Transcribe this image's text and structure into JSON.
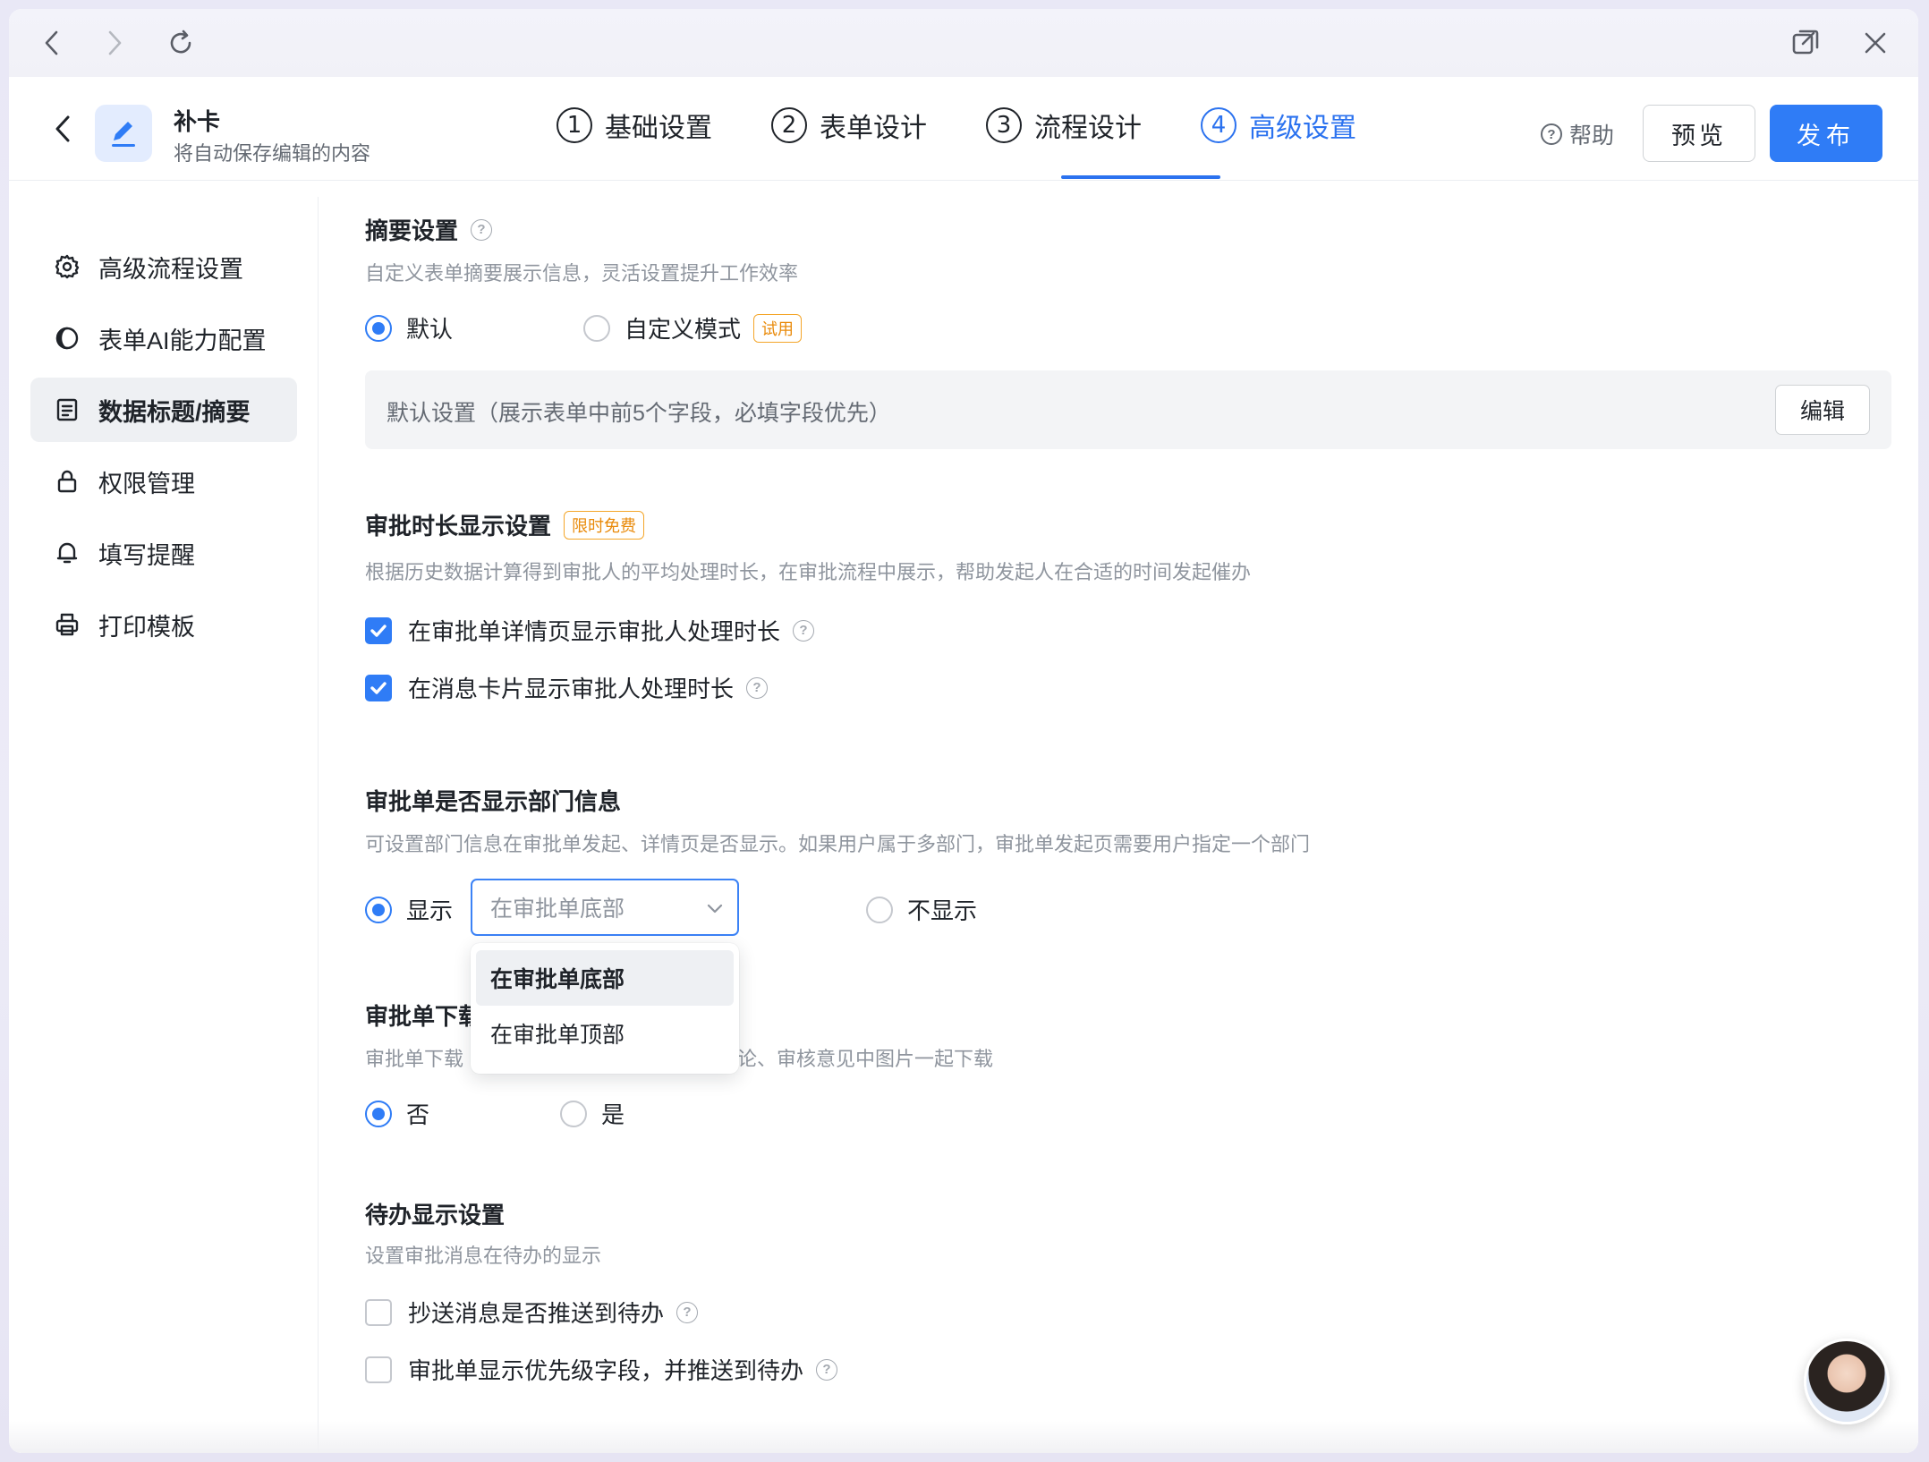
{
  "app": {
    "title": "补卡",
    "subtitle": "将自动保存编辑的内容"
  },
  "steps": [
    {
      "num": "1",
      "label": "基础设置",
      "active": false
    },
    {
      "num": "2",
      "label": "表单设计",
      "active": false
    },
    {
      "num": "3",
      "label": "流程设计",
      "active": false
    },
    {
      "num": "4",
      "label": "高级设置",
      "active": true
    }
  ],
  "header": {
    "help_label": "帮助",
    "preview_label": "预览",
    "publish_label": "发布"
  },
  "sidebar": {
    "items": [
      {
        "label": "高级流程设置",
        "icon": "gear-icon"
      },
      {
        "label": "表单AI能力配置",
        "icon": "ai-icon"
      },
      {
        "label": "数据标题/摘要",
        "icon": "document-icon",
        "active": true
      },
      {
        "label": "权限管理",
        "icon": "lock-icon"
      },
      {
        "label": "填写提醒",
        "icon": "bell-icon"
      },
      {
        "label": "打印模板",
        "icon": "printer-icon"
      }
    ]
  },
  "summary": {
    "title": "摘要设置",
    "desc": "自定义表单摘要展示信息，灵活设置提升工作效率",
    "option_default": "默认",
    "option_custom": "自定义模式",
    "trial_tag": "试用",
    "default_text": "默认设置（展示表单中前5个字段，必填字段优先）",
    "edit_label": "编辑"
  },
  "duration": {
    "title": "审批时长显示设置",
    "tag": "限时免费",
    "desc": "根据历史数据计算得到审批人的平均处理时长，在审批流程中展示，帮助发起人在合适的时间发起催办",
    "check1": "在审批单详情页显示审批人处理时长",
    "check2": "在消息卡片显示审批人处理时长"
  },
  "department": {
    "title": "审批单是否显示部门信息",
    "desc": "可设置部门信息在审批单发起、详情页是否显示。如果用户属于多部门，审批单发起页需要用户指定一个部门",
    "show_label": "显示",
    "select_value": "在审批单底部",
    "hide_label": "不显示",
    "options": [
      "在审批单底部",
      "在审批单顶部"
    ]
  },
  "download": {
    "title_visible": "审批单下载",
    "desc_left": "审批单下载",
    "desc_right": "论、审核意见中图片一起下载",
    "option_no": "否",
    "option_yes": "是"
  },
  "todo": {
    "title": "待办显示设置",
    "desc": "设置审批消息在待办的显示",
    "check1": "抄送消息是否推送到待办",
    "check2": "审批单显示优先级字段，并推送到待办"
  },
  "colors": {
    "accent": "#2f7cf6",
    "tag_orange": "#e98a0a"
  }
}
